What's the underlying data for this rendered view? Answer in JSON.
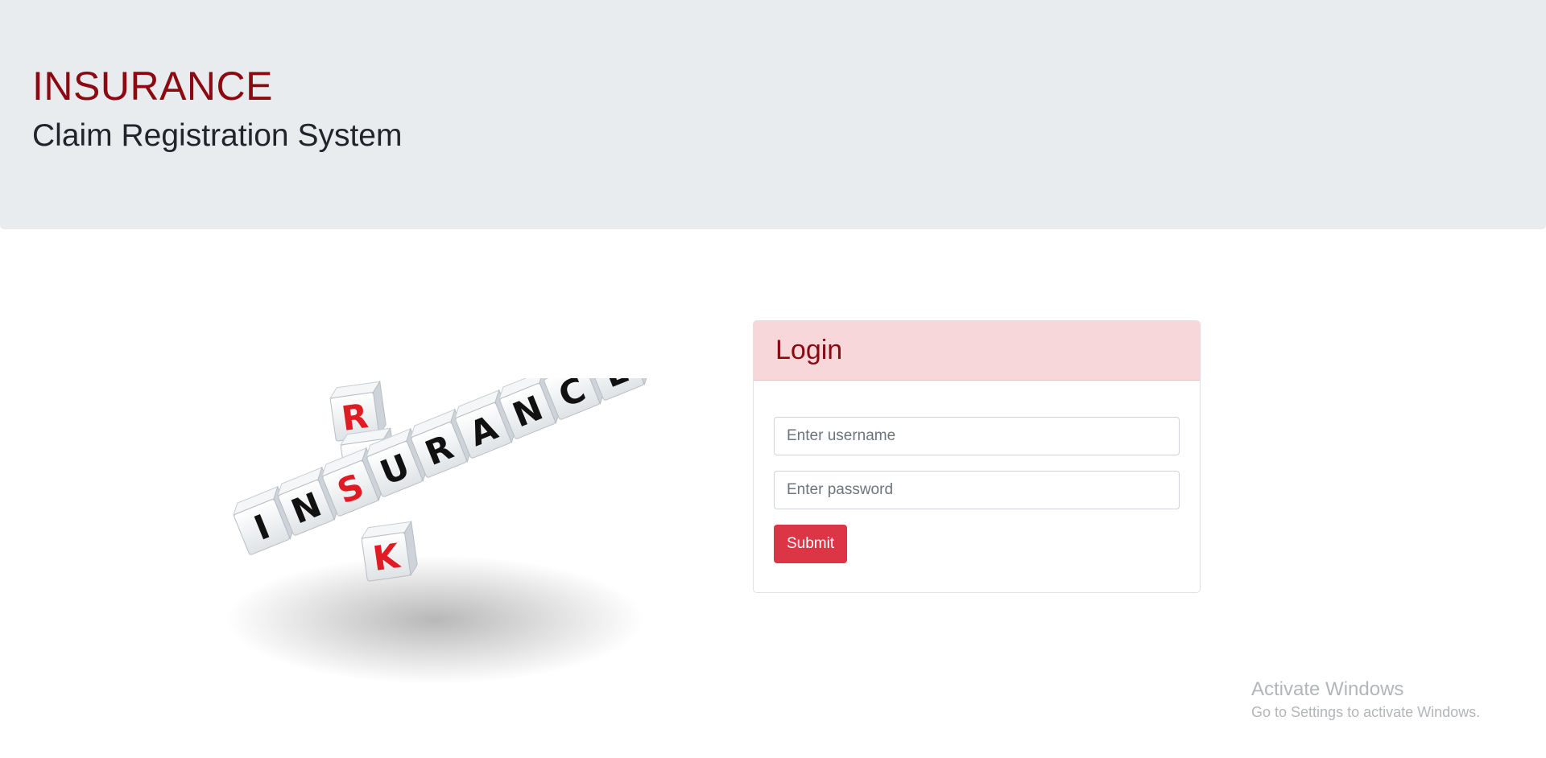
{
  "header": {
    "title": "INSURANCE",
    "subtitle": "Claim Registration System"
  },
  "illustration": {
    "word_horizontal": "INSURANCE",
    "word_vertical": "RISK"
  },
  "login": {
    "heading": "Login",
    "username_placeholder": "Enter username",
    "password_placeholder": "Enter password",
    "submit_label": "Submit"
  },
  "watermark": {
    "title": "Activate Windows",
    "subtitle": "Go to Settings to activate Windows."
  },
  "colors": {
    "brand": "#8b0a12",
    "jumbotron": "#e9ecef",
    "card_header": "#f8d7da",
    "submit": "#dc3545",
    "cube_red_letter": "#e01b24",
    "cube_black_letter": "#111111"
  }
}
